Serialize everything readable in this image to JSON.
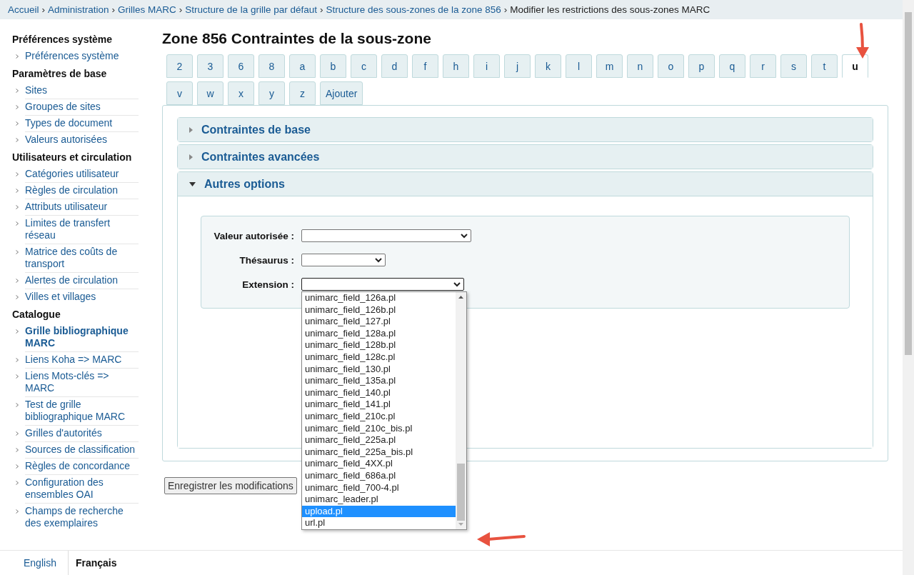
{
  "breadcrumb": {
    "separator": "›",
    "items": [
      {
        "label": "Accueil",
        "kind": "link"
      },
      {
        "label": "Administration",
        "kind": "link"
      },
      {
        "label": "Grilles MARC",
        "kind": "link"
      },
      {
        "label": "Structure de la grille par défaut",
        "kind": "link"
      },
      {
        "label": "Structure des sous-zones de la zone 856",
        "kind": "link"
      },
      {
        "label": "Modifier les restrictions des sous-zones MARC",
        "kind": "current"
      }
    ]
  },
  "sidebar": {
    "sections": [
      {
        "heading": "Préférences système",
        "items": [
          {
            "label": "Préférences système",
            "selected": false
          }
        ]
      },
      {
        "heading": "Paramètres de base",
        "items": [
          {
            "label": "Sites",
            "selected": false
          },
          {
            "label": "Groupes de sites",
            "selected": false
          },
          {
            "label": "Types de document",
            "selected": false
          },
          {
            "label": "Valeurs autorisées",
            "selected": false
          }
        ]
      },
      {
        "heading": "Utilisateurs et circulation",
        "items": [
          {
            "label": "Catégories utilisateur",
            "selected": false
          },
          {
            "label": "Règles de circulation",
            "selected": false
          },
          {
            "label": "Attributs utilisateur",
            "selected": false
          },
          {
            "label": "Limites de transfert réseau",
            "selected": false
          },
          {
            "label": "Matrice des coûts de transport",
            "selected": false
          },
          {
            "label": "Alertes de circulation",
            "selected": false
          },
          {
            "label": "Villes et villages",
            "selected": false
          }
        ]
      },
      {
        "heading": "Catalogue",
        "items": [
          {
            "label": "Grille bibliographique MARC",
            "selected": true
          },
          {
            "label": "Liens Koha => MARC",
            "selected": false
          },
          {
            "label": "Liens Mots-clés => MARC",
            "selected": false
          },
          {
            "label": "Test de grille bibliographique MARC",
            "selected": false
          },
          {
            "label": "Grilles d'autorités",
            "selected": false
          },
          {
            "label": "Sources de classification",
            "selected": false
          },
          {
            "label": "Règles de concordance",
            "selected": false
          },
          {
            "label": "Configuration des ensembles OAI",
            "selected": false
          },
          {
            "label": "Champs de recherche des exemplaires",
            "selected": false
          }
        ]
      }
    ]
  },
  "languages": [
    {
      "label": "English",
      "selected": false
    },
    {
      "label": "Français",
      "selected": true
    }
  ],
  "page_title": "Zone 856 Contraintes de la sous-zone",
  "tabs": [
    {
      "label": "2",
      "selected": false
    },
    {
      "label": "3",
      "selected": false
    },
    {
      "label": "6",
      "selected": false
    },
    {
      "label": "8",
      "selected": false
    },
    {
      "label": "a",
      "selected": false
    },
    {
      "label": "b",
      "selected": false
    },
    {
      "label": "c",
      "selected": false
    },
    {
      "label": "d",
      "selected": false
    },
    {
      "label": "f",
      "selected": false
    },
    {
      "label": "h",
      "selected": false
    },
    {
      "label": "i",
      "selected": false
    },
    {
      "label": "j",
      "selected": false
    },
    {
      "label": "k",
      "selected": false
    },
    {
      "label": "l",
      "selected": false
    },
    {
      "label": "m",
      "selected": false
    },
    {
      "label": "n",
      "selected": false
    },
    {
      "label": "o",
      "selected": false
    },
    {
      "label": "p",
      "selected": false
    },
    {
      "label": "q",
      "selected": false
    },
    {
      "label": "r",
      "selected": false
    },
    {
      "label": "s",
      "selected": false
    },
    {
      "label": "t",
      "selected": false
    },
    {
      "label": "u",
      "selected": true
    },
    {
      "label": "v",
      "selected": false
    },
    {
      "label": "w",
      "selected": false
    },
    {
      "label": "x",
      "selected": false
    },
    {
      "label": "y",
      "selected": false
    },
    {
      "label": "z",
      "selected": false
    },
    {
      "label": "Ajouter",
      "selected": false
    }
  ],
  "panels": [
    {
      "title": "Contraintes de base",
      "expanded": false
    },
    {
      "title": "Contraintes avancées",
      "expanded": false
    },
    {
      "title": "Autres options",
      "expanded": true
    }
  ],
  "form": {
    "authorised_value": {
      "label": "Valeur autorisée :"
    },
    "thesaurus": {
      "label": "Thésaurus :"
    },
    "extension": {
      "label": "Extension :",
      "open": true,
      "options": [
        {
          "label": "unimarc_field_126a.pl",
          "selected": false
        },
        {
          "label": "unimarc_field_126b.pl",
          "selected": false
        },
        {
          "label": "unimarc_field_127.pl",
          "selected": false
        },
        {
          "label": "unimarc_field_128a.pl",
          "selected": false
        },
        {
          "label": "unimarc_field_128b.pl",
          "selected": false
        },
        {
          "label": "unimarc_field_128c.pl",
          "selected": false
        },
        {
          "label": "unimarc_field_130.pl",
          "selected": false
        },
        {
          "label": "unimarc_field_135a.pl",
          "selected": false
        },
        {
          "label": "unimarc_field_140.pl",
          "selected": false
        },
        {
          "label": "unimarc_field_141.pl",
          "selected": false
        },
        {
          "label": "unimarc_field_210c.pl",
          "selected": false
        },
        {
          "label": "unimarc_field_210c_bis.pl",
          "selected": false
        },
        {
          "label": "unimarc_field_225a.pl",
          "selected": false
        },
        {
          "label": "unimarc_field_225a_bis.pl",
          "selected": false
        },
        {
          "label": "unimarc_field_4XX.pl",
          "selected": false
        },
        {
          "label": "unimarc_field_686a.pl",
          "selected": false
        },
        {
          "label": "unimarc_field_700-4.pl",
          "selected": false
        },
        {
          "label": "unimarc_leader.pl",
          "selected": false
        },
        {
          "label": "upload.pl",
          "selected": true
        },
        {
          "label": "url.pl",
          "selected": false
        }
      ]
    }
  },
  "save_button": "Enregistrer les modifications"
}
